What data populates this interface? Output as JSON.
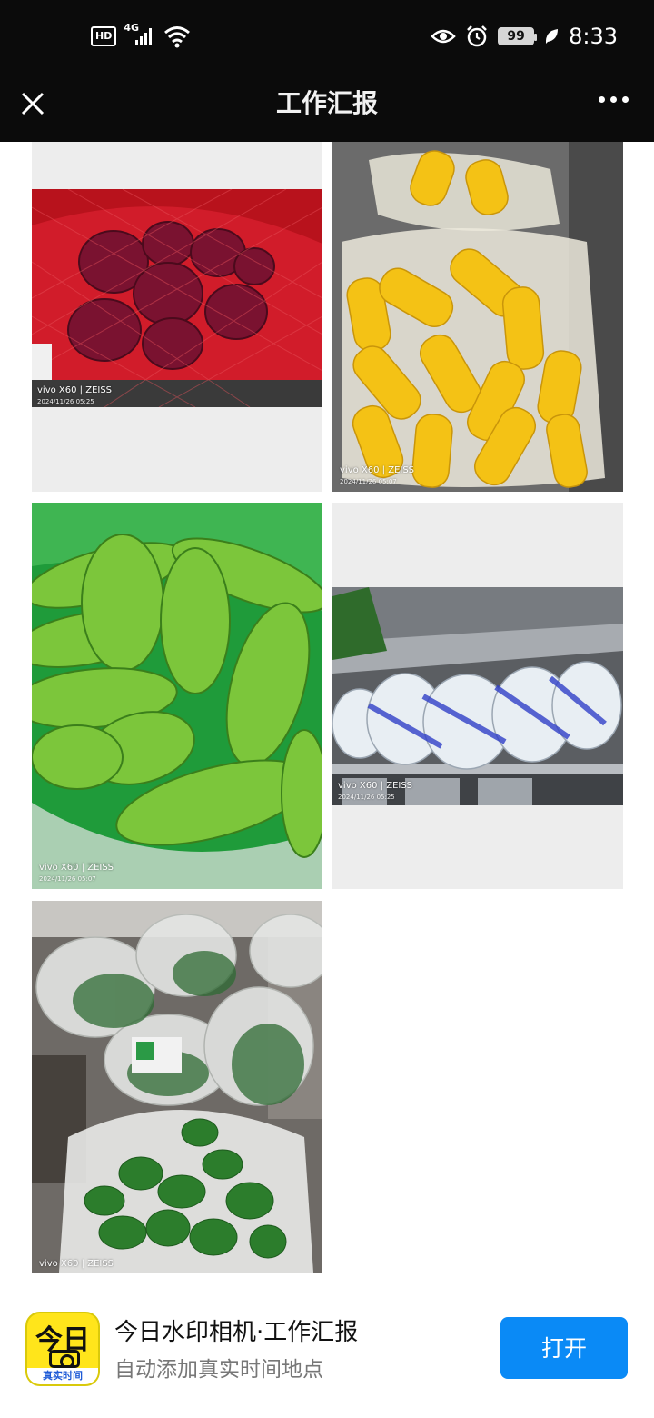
{
  "status_bar": {
    "hd": "HD",
    "network": "4G",
    "battery": "99",
    "time": "8:33"
  },
  "app_bar": {
    "title": "工作汇报"
  },
  "photos": [
    {
      "subject": "red onions in a red mesh bag",
      "watermark": "vivo X60 | ZEISS",
      "date": "2024/11/26 05:25"
    },
    {
      "subject": "yellow corn cobs in plastic bags",
      "watermark": "vivo X60 | ZEISS",
      "date": "2024/11/26 05:07"
    },
    {
      "subject": "green bitter melons",
      "watermark": "vivo X60 | ZEISS",
      "date": "2024/11/26 05:07"
    },
    {
      "subject": "bagged vegetables on stainless shelf",
      "watermark": "vivo X60 | ZEISS",
      "date": "2024/11/26 05:25"
    },
    {
      "subject": "bags of leafy greens / spinach",
      "watermark": "vivo X60 | ZEISS",
      "date": ""
    }
  ],
  "banner": {
    "icon_big_text": "今日",
    "icon_strip_text": "真实时间",
    "app_name": "今日水印相机·工作汇报",
    "subtitle": "自动添加真实时间地点",
    "open_label": "打开"
  },
  "colors": {
    "bar_bg": "#0b0b0b",
    "open_button": "#0a8af6",
    "icon_yellow": "#ffe51b"
  }
}
